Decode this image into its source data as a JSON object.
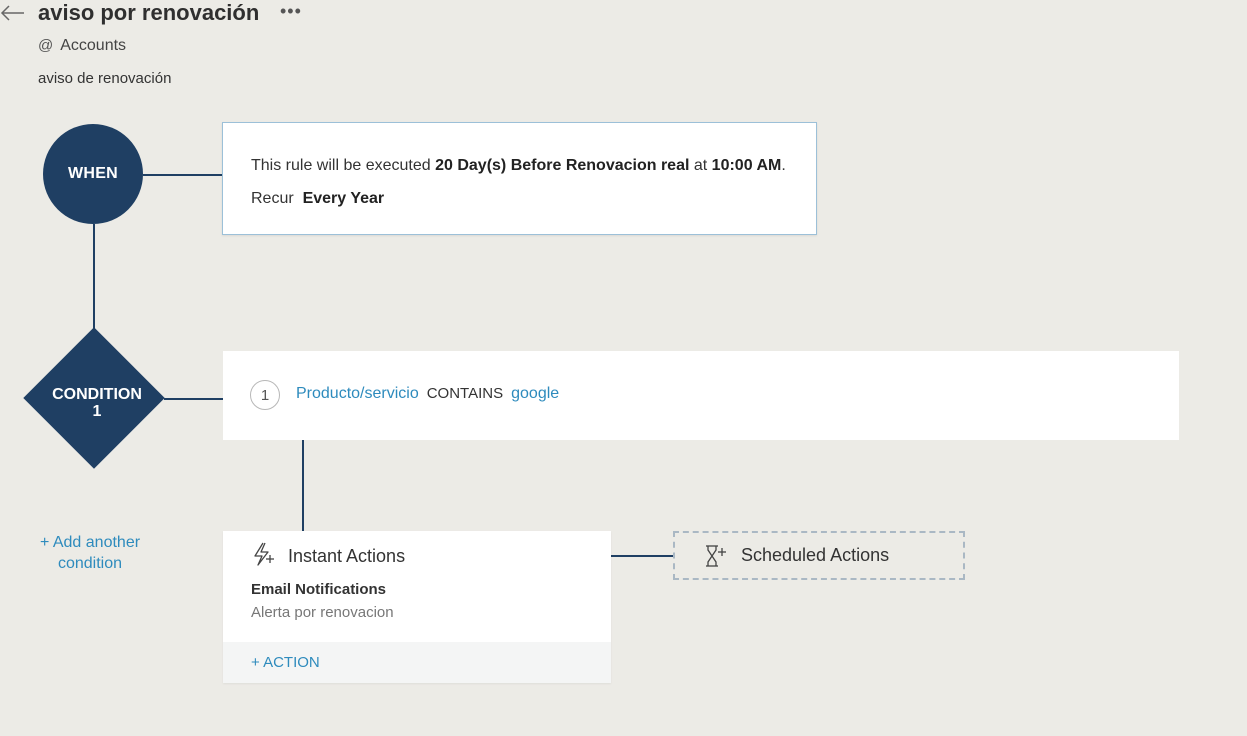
{
  "header": {
    "title": "aviso por renovación",
    "more_label": "•••",
    "module_prefix": "@",
    "module": "Accounts",
    "description": "aviso de renovación"
  },
  "when": {
    "node_label": "WHEN",
    "line1_pre": "This rule will be executed",
    "line1_bold1": "20 Day(s) Before Renovacion real",
    "line1_mid": "at",
    "line1_bold2": "10:00 AM",
    "line1_end": ".",
    "recur_label": "Recur",
    "recur_value": "Every Year"
  },
  "condition": {
    "node_label": "CONDITION",
    "node_number": "1",
    "criteria_number": "1",
    "field": "Producto/servicio",
    "operator": "CONTAINS",
    "value": "google",
    "add_another_line1": "+ Add another",
    "add_another_line2": "condition"
  },
  "instant_actions": {
    "title": "Instant Actions",
    "item_type": "Email Notifications",
    "item_name": "Alerta por renovacion",
    "add_action": "+ ACTION"
  },
  "scheduled_actions": {
    "title": "Scheduled Actions"
  },
  "colors": {
    "node": "#1f3f63",
    "link": "#2e8bbd",
    "background": "#ecebe6"
  },
  "icons": {
    "back": "arrow-left-icon",
    "more": "more-options-icon",
    "instant": "lightning-plus-icon",
    "scheduled": "hourglass-plus-icon"
  }
}
